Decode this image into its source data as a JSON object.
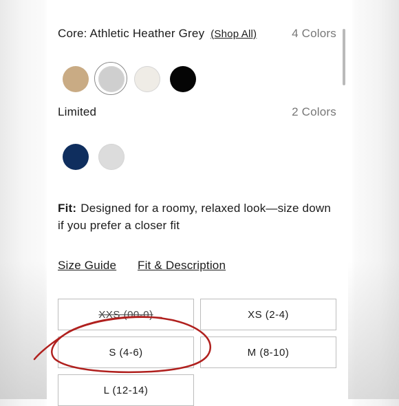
{
  "colors": {
    "core": {
      "label": "Core: Athletic Heather Grey",
      "shop_all": "(Shop All)",
      "count": "4 Colors",
      "swatches": [
        {
          "name": "tan",
          "hex": "#c9ab84",
          "selected": false
        },
        {
          "name": "athletic-heather-grey",
          "hex": "#cfcfcf",
          "selected": true
        },
        {
          "name": "off-white",
          "hex": "#efece6",
          "selected": false
        },
        {
          "name": "black",
          "hex": "#050505",
          "selected": false
        }
      ]
    },
    "limited": {
      "label": "Limited",
      "count": "2 Colors",
      "swatches": [
        {
          "name": "navy",
          "hex": "#0f2e5e",
          "selected": false
        },
        {
          "name": "light-grey",
          "hex": "#dcdcdc",
          "selected": false
        }
      ]
    }
  },
  "fit": {
    "label": "Fit:",
    "text": "Designed for a roomy, relaxed look—size down if you prefer a closer fit"
  },
  "links": {
    "size_guide": "Size Guide",
    "fit_description": "Fit & Description"
  },
  "sizes": [
    {
      "label": "XXS (00-0)",
      "unavailable": true
    },
    {
      "label": "XS (2-4)",
      "unavailable": false
    },
    {
      "label": "S (4-6)",
      "unavailable": false,
      "circled": true
    },
    {
      "label": "M (8-10)",
      "unavailable": false
    },
    {
      "label": "L (12-14)",
      "unavailable": false
    }
  ],
  "annotation_color": "#b0201e"
}
